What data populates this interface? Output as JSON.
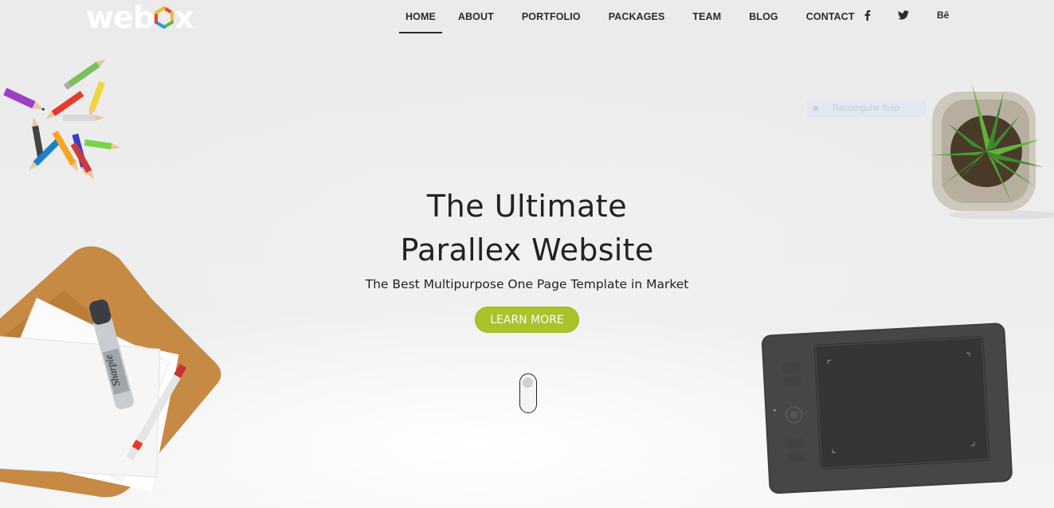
{
  "brand": {
    "logo_pre": "web",
    "logo_post": "x",
    "colors": {
      "logo_text": "#ffffff",
      "hex_red": "#e8432e",
      "hex_yellow": "#f5b82e",
      "hex_green": "#5cb85c",
      "hex_blue": "#2c9ad6"
    }
  },
  "nav": {
    "items": [
      {
        "label": "HOME",
        "active": true
      },
      {
        "label": "ABOUT",
        "active": false
      },
      {
        "label": "PORTFOLIO",
        "active": false
      },
      {
        "label": "PACKAGES",
        "active": false
      },
      {
        "label": "TEAM",
        "active": false
      },
      {
        "label": "BLOG",
        "active": false
      },
      {
        "label": "CONTACT",
        "active": false
      }
    ],
    "social": [
      {
        "icon": "facebook-icon"
      },
      {
        "icon": "twitter-icon"
      },
      {
        "icon": "behance-icon",
        "label": "Bē"
      }
    ]
  },
  "hero": {
    "title_line1": "The Ultimate",
    "title_line2": "Parallex Website",
    "subtitle": "The Best Multipurpose One Page Template in Market",
    "cta_label": "LEARN MORE",
    "cta_color": "#a8c42a"
  },
  "overlay": {
    "snip_label": "Rectangular Snip"
  },
  "decor": {
    "pen_brand": "Sharpie",
    "items": [
      "colored-pencils",
      "paper-folder-with-marker",
      "potted-plant",
      "drawing-tablet",
      "scroll-mouse-icon"
    ]
  }
}
